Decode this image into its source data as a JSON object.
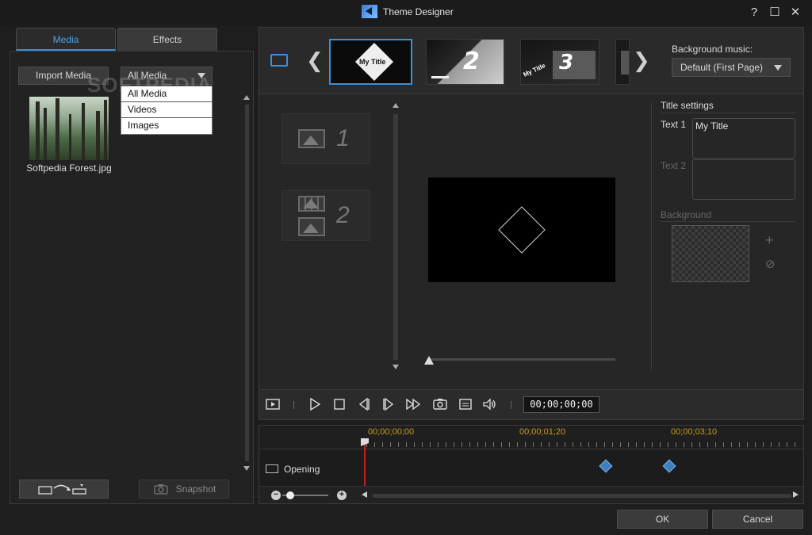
{
  "window": {
    "title": "Theme Designer",
    "help_label": "?",
    "maximize_glyph": "☐",
    "close_glyph": "✕"
  },
  "left_panel": {
    "tabs": [
      {
        "label": "Media",
        "active": true
      },
      {
        "label": "Effects",
        "active": false
      }
    ],
    "import_button_label": "Import Media",
    "filter": {
      "selected": "All Media",
      "options": [
        "All Media",
        "Videos",
        "Images"
      ]
    },
    "media_items": [
      {
        "caption": "Softpedia Forest.jpg"
      }
    ],
    "snapshot_label": "Snapshot",
    "watermark": "SOFTPEDIA"
  },
  "template_strip": {
    "templates": [
      {
        "label": "My Title",
        "selected": true
      },
      {
        "label": "2",
        "selected": false
      },
      {
        "label": "3",
        "sublabel": "My Title",
        "selected": false
      },
      {
        "label": "",
        "selected": false
      }
    ],
    "prev_glyph": "❮",
    "next_glyph": "❯"
  },
  "background_music": {
    "label": "Background music:",
    "selected": "Default (First Page)"
  },
  "slots": [
    {
      "number": "1"
    },
    {
      "number": "2"
    }
  ],
  "title_settings": {
    "heading": "Title settings",
    "text1_label": "Text 1",
    "text1_value": "My Title",
    "text2_label": "Text 2",
    "text2_value": "",
    "background_label": "Background",
    "add_glyph": "+",
    "remove_glyph": "⊘"
  },
  "playback": {
    "timecode": "00;00;00;00"
  },
  "timeline": {
    "ruler_marks": [
      "00;00;00;00",
      "00;00;01;20",
      "00;00;03;10"
    ],
    "track_label": "Opening",
    "keyframe_count": 2
  },
  "footer": {
    "ok_label": "OK",
    "cancel_label": "Cancel"
  },
  "colors": {
    "accent": "#3d8fd6",
    "ruler_text": "#c79a22",
    "playhead": "#c21f1f",
    "keyframe": "#3f7fc0"
  }
}
